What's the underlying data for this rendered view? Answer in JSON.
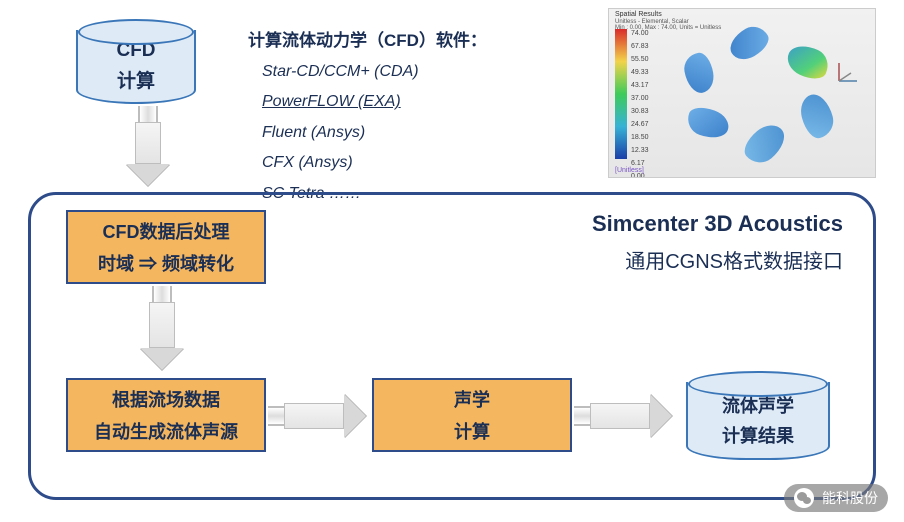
{
  "cfd": {
    "title": "CFD",
    "subtitle": "计算"
  },
  "software": {
    "header": "计算流体动力学（CFD）软件：",
    "items": [
      "Star-CD/CCM+ (CDA)",
      "PowerFLOW (EXA)",
      "Fluent (Ansys)",
      "CFX (Ansys)",
      "SC Tetra ……"
    ],
    "underline_index": 1
  },
  "thumb": {
    "title": "Spatial Results",
    "subtitle_prefix": "Unitless - Elemental, Scalar",
    "subtitle_range": "Min : 0.00, Max : 74.00, Units = Unitless",
    "legend_ticks": [
      "74.00",
      "67.83",
      "55.50",
      "49.33",
      "43.17",
      "37.00",
      "30.83",
      "24.67",
      "18.50",
      "12.33",
      "6.17",
      "0.00"
    ],
    "footer": "[Unitless]"
  },
  "container": {
    "title": "Simcenter 3D Acoustics",
    "subtitle": "通用CGNS格式数据接口"
  },
  "proc1": {
    "line1": "CFD数据后处理",
    "line2_a": "时域 ",
    "line2_arrow": "⇒",
    "line2_b": " 频域转化"
  },
  "proc2": {
    "line1": "根据流场数据",
    "line2": "自动生成流体声源"
  },
  "proc3": {
    "line1": "声学",
    "line2": "计算"
  },
  "result": {
    "line1": "流体声学",
    "line2": "计算结果"
  },
  "watermark": "能科股份"
}
